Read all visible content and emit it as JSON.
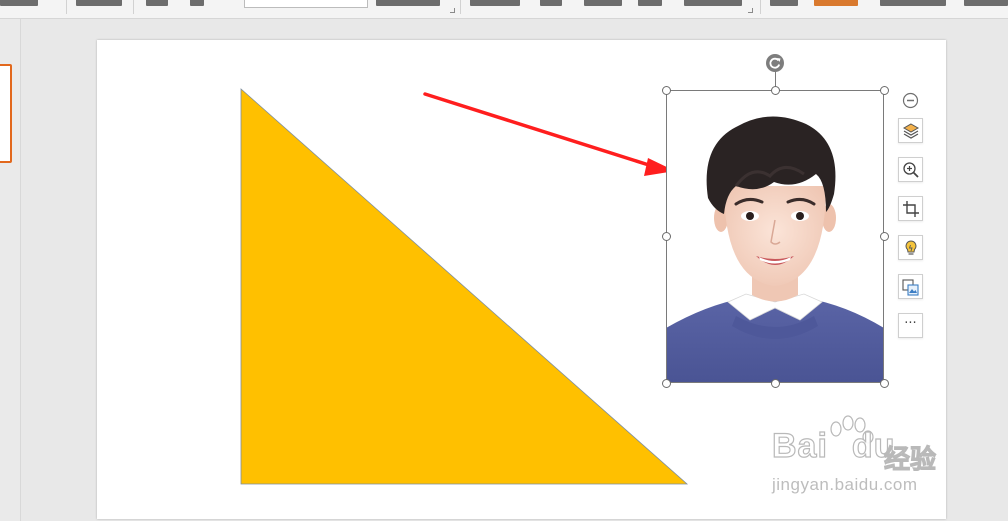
{
  "app": {
    "name": "Presentation editor"
  },
  "slide": {
    "shape": {
      "kind": "right-triangle",
      "fill": "#FFC000",
      "stroke": "#7f8f9f"
    },
    "arrow": {
      "color": "#FF1E1E"
    },
    "picture": {
      "subject": "portrait-photo",
      "background": "#ffffff",
      "sweater_color": "#4f5a9c"
    }
  },
  "float_toolbar": {
    "items": [
      {
        "name": "collapse",
        "icon": "minus-circle-icon"
      },
      {
        "name": "layers",
        "icon": "layers-icon"
      },
      {
        "name": "zoom",
        "icon": "zoom-in-icon"
      },
      {
        "name": "crop",
        "icon": "crop-icon"
      },
      {
        "name": "smart-tip",
        "icon": "lightbulb-icon"
      },
      {
        "name": "replace-picture",
        "icon": "picture-replace-icon"
      },
      {
        "name": "more",
        "icon": "ellipsis-icon",
        "label": "···"
      }
    ]
  },
  "watermark": {
    "brand": "Bai",
    "brand_rest": "du",
    "cn": "经验",
    "url": "jingyan.baidu.com"
  },
  "colors": {
    "thumb_selected": "#e2681d",
    "canvas_bg": "#e8e8e8"
  }
}
